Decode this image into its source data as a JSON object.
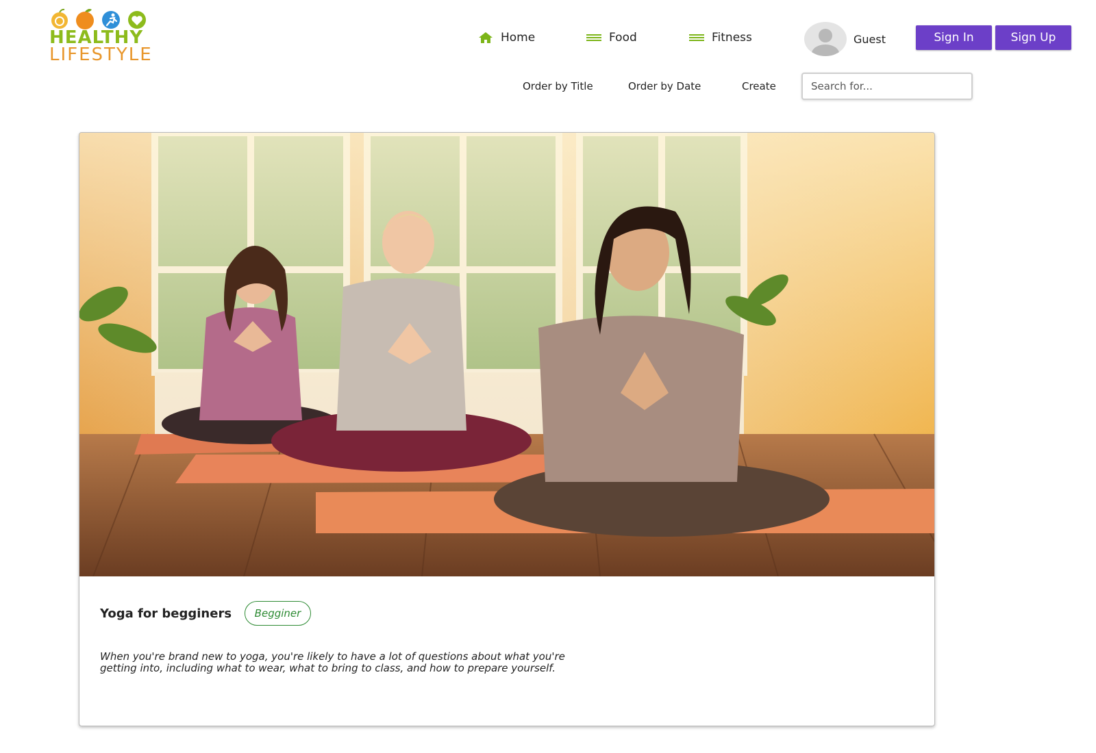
{
  "logo": {
    "line1": "HEALTHY",
    "line2": "LIFESTYLE",
    "icons": [
      "apple-icon",
      "orange-icon",
      "runner-icon",
      "heart-icon"
    ]
  },
  "nav": {
    "home_label": "Home",
    "food_label": "Food",
    "fitness_label": "Fitness",
    "home_icon": "house-icon",
    "menu_icon": "hamburger-icon"
  },
  "user": {
    "name": "Guest",
    "sign_in_label": "Sign In",
    "sign_up_label": "Sign Up"
  },
  "subnav": {
    "order_title": "Order by Title",
    "order_date": "Order by Date",
    "create": "Create",
    "search_placeholder": "Search for..."
  },
  "card": {
    "title": "Yoga for begginers",
    "badge": "Begginer",
    "description": "When you're brand new to yoga, you're likely to have a lot of questions about what you're getting into, including what to wear, what to bring to class, and how to prepare yourself."
  },
  "colors": {
    "brand_green": "#8dbb1c",
    "brand_orange": "#e8962b",
    "button_purple": "#6c3fc8",
    "badge_green": "#2c8a32"
  }
}
